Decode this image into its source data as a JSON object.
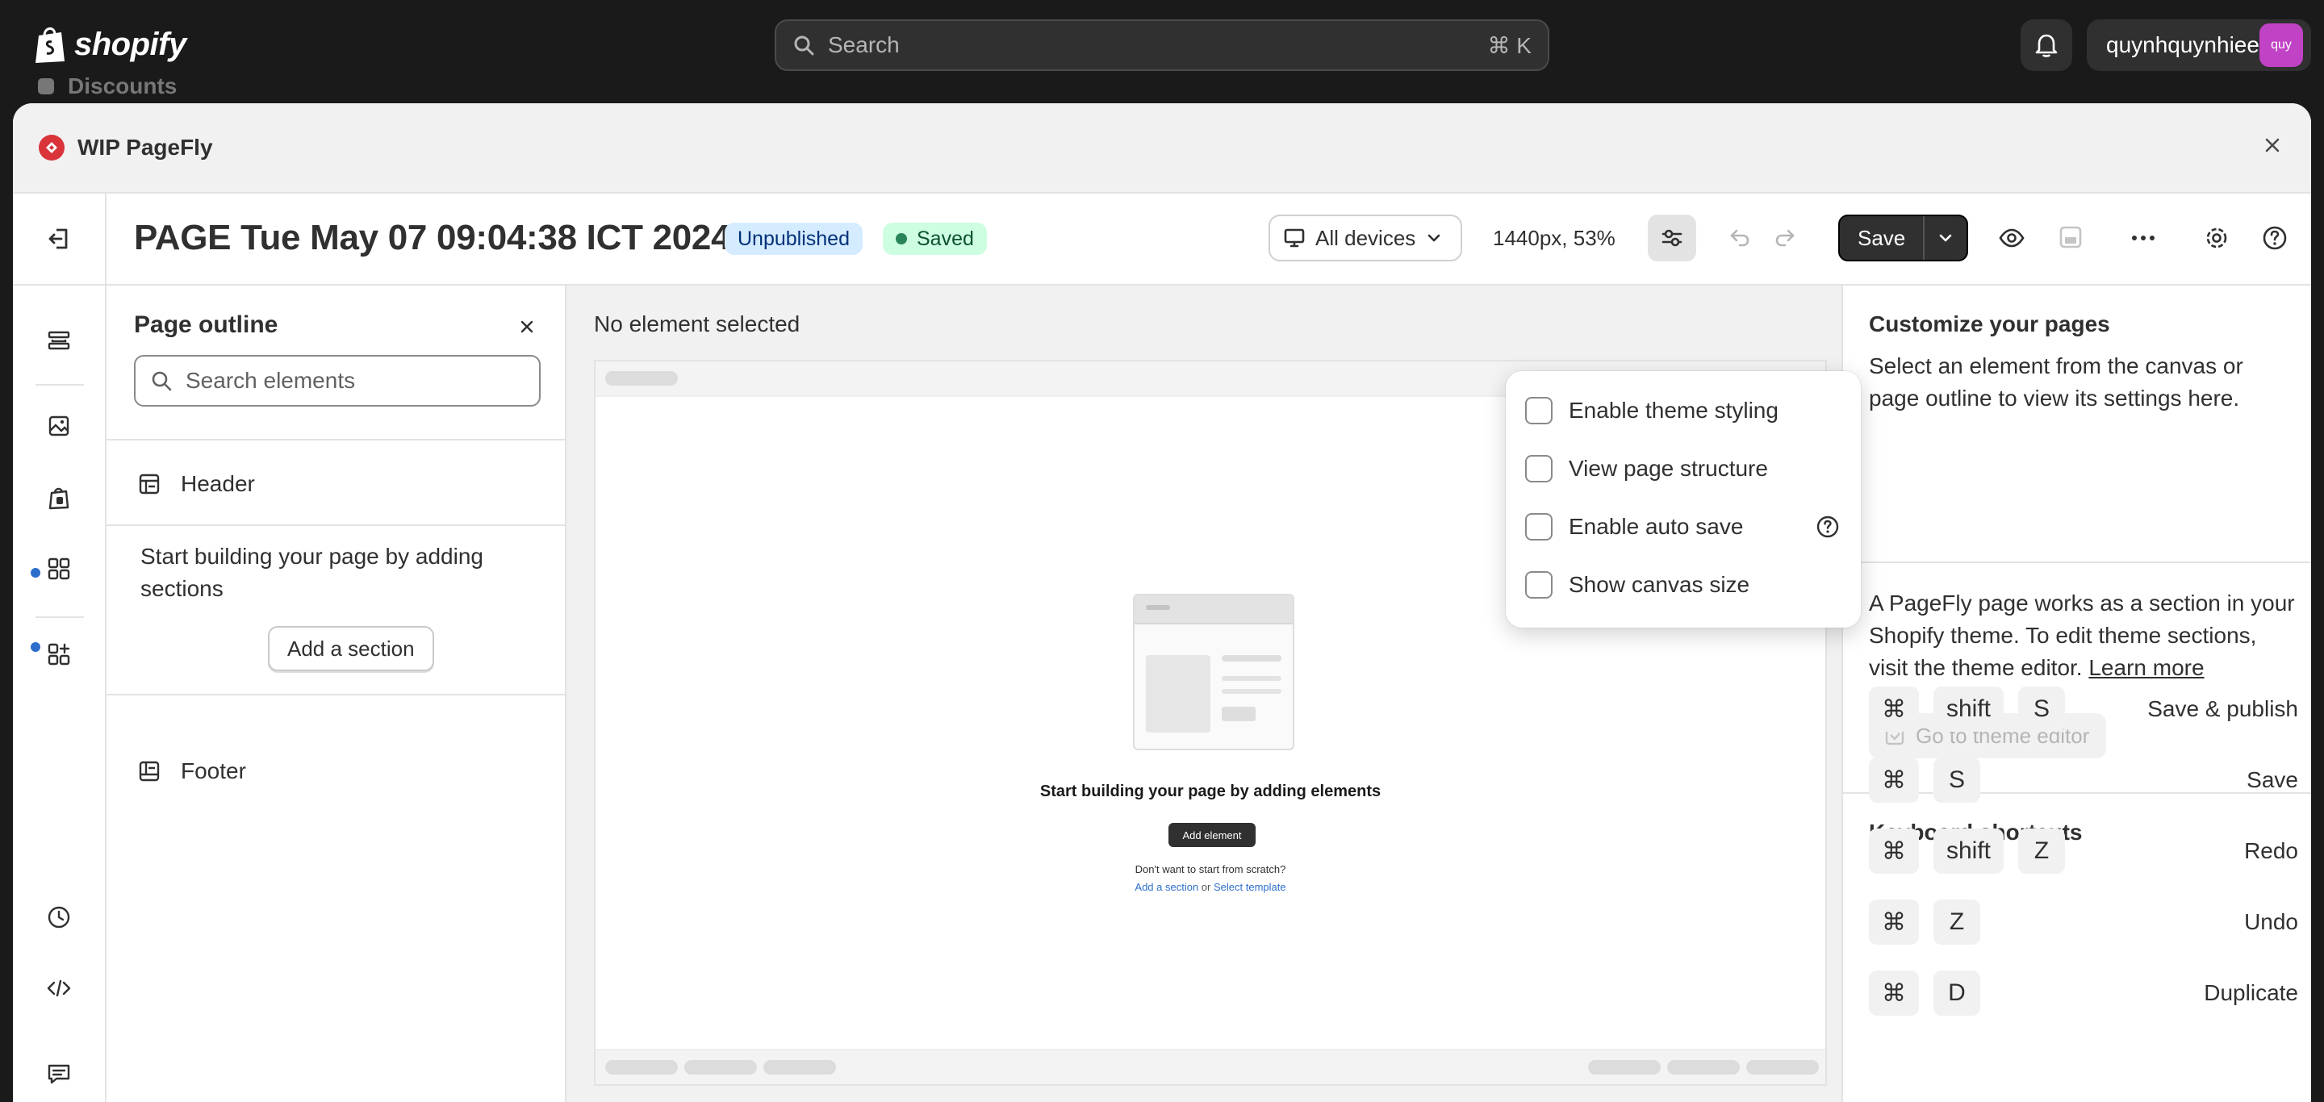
{
  "topbar": {
    "logo_text": "shopify",
    "search_placeholder": "Search",
    "search_shortcut": "⌘ K",
    "user_name": "quynhquynhiee",
    "avatar_text": "quy",
    "behind_label": "Discounts"
  },
  "modal": {
    "title": "WIP PageFly"
  },
  "toolbar": {
    "page_title": "PAGE Tue May 07 09:04:38 ICT 2024",
    "status_unpublished": "Unpublished",
    "status_saved": "Saved",
    "device_select": "All devices",
    "zoom": "1440px, 53%",
    "save_label": "Save"
  },
  "outline": {
    "title": "Page outline",
    "search_placeholder": "Search elements",
    "header_label": "Header",
    "hint": "Start building your page by adding sections",
    "add_section": "Add a section",
    "footer_label": "Footer"
  },
  "canvas": {
    "no_selection": "No element selected",
    "empty_title": "Start building your page by adding elements",
    "add_element": "Add element",
    "empty_sub": "Don't want to start from scratch?",
    "link_add_section": "Add a section",
    "link_or": " or ",
    "link_select_template": "Select template"
  },
  "dropdown": {
    "items": [
      {
        "label": "Enable theme styling",
        "checked": false
      },
      {
        "label": "View page structure",
        "checked": false
      },
      {
        "label": "Enable auto save",
        "checked": false
      },
      {
        "label": "Show canvas size",
        "checked": false
      }
    ]
  },
  "right_panel": {
    "title": "Customize your pages",
    "select_hint": "Select an element from the canvas or page outline to view its settings here.",
    "theme_info": "A PageFly page works as a section in your Shopify theme. To edit theme sections, visit the theme editor.",
    "learn_more": "Learn more",
    "theme_editor_btn": "Go to theme editor",
    "shortcuts_title": "Keyboard shortcuts",
    "shortcuts": [
      {
        "keys": [
          "⌘",
          "shift",
          "S"
        ],
        "label": "Save & publish"
      },
      {
        "keys": [
          "⌘",
          "S"
        ],
        "label": "Save"
      },
      {
        "keys": [
          "⌘",
          "shift",
          "Z"
        ],
        "label": "Redo"
      },
      {
        "keys": [
          "⌘",
          "Z"
        ],
        "label": "Undo"
      },
      {
        "keys": [
          "⌘",
          "D"
        ],
        "label": "Duplicate"
      }
    ]
  },
  "colors": {
    "topbar_bg": "#1a1a1a",
    "primary_button": "#303030",
    "unpublished_badge": "#d5ebff",
    "saved_badge": "#cdfee1",
    "link": "#2c6ecb",
    "avatar": "#c042c5"
  }
}
